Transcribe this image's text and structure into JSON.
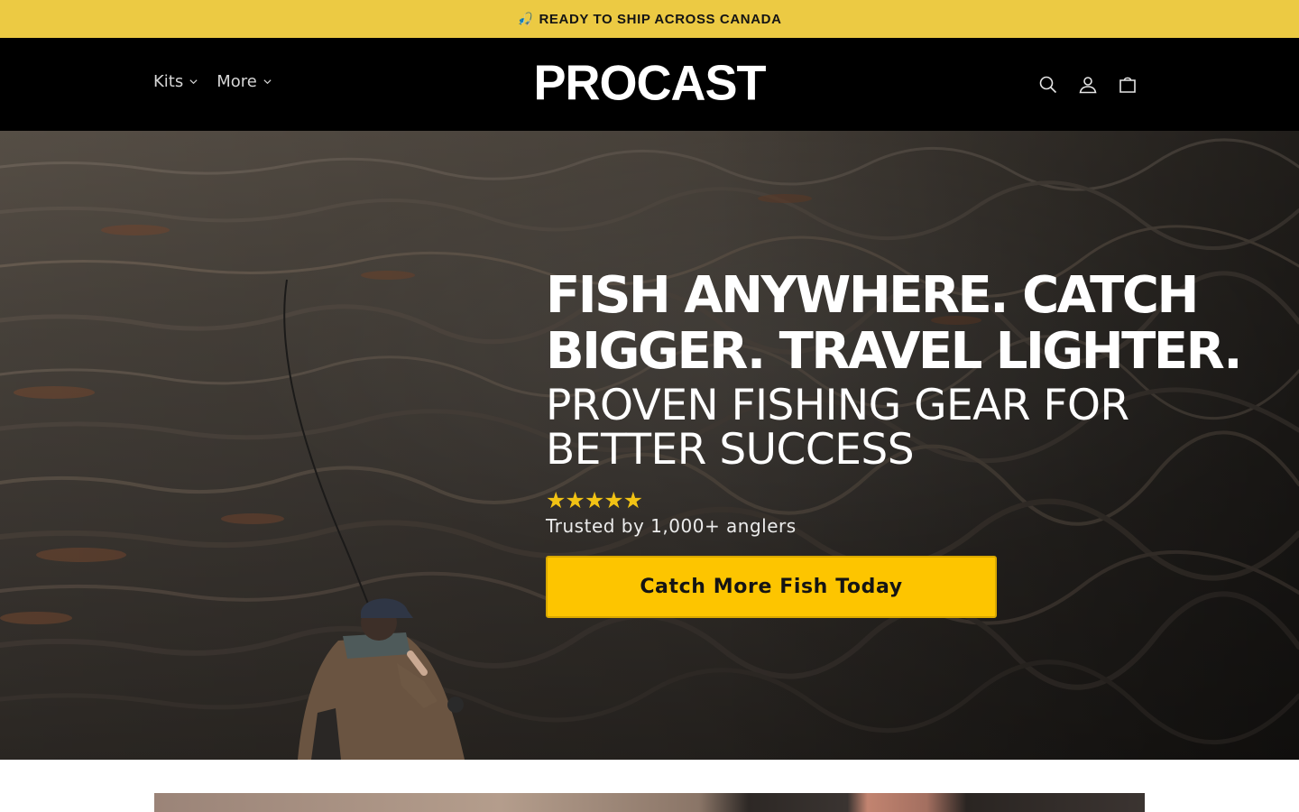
{
  "announcement": {
    "icon": "fishing-rod-icon",
    "text": "READY TO SHIP ACROSS CANADA"
  },
  "header": {
    "nav": [
      {
        "label": "Kits",
        "icon": "chevron-down-icon"
      },
      {
        "label": "More",
        "icon": "chevron-down-icon"
      }
    ],
    "logo_text": "PROCAST",
    "icons": [
      "search-icon",
      "account-icon",
      "cart-icon"
    ]
  },
  "hero": {
    "headline_line1": "FISH ANYWHERE. CATCH",
    "headline_line2": "BIGGER. TRAVEL LIGHTER.",
    "subheadline_line1": "PROVEN FISHING GEAR FOR",
    "subheadline_line2": "BETTER SUCCESS",
    "stars": "★★★★★",
    "rating": 5,
    "trust_text": "Trusted by 1,000+ anglers",
    "cta_label": "Catch More Fish Today"
  },
  "colors": {
    "announcement_bg": "#ecca43",
    "header_bg": "#000000",
    "cta_bg": "#fdc500",
    "star": "#f2c314",
    "text_light": "#ffffff"
  }
}
